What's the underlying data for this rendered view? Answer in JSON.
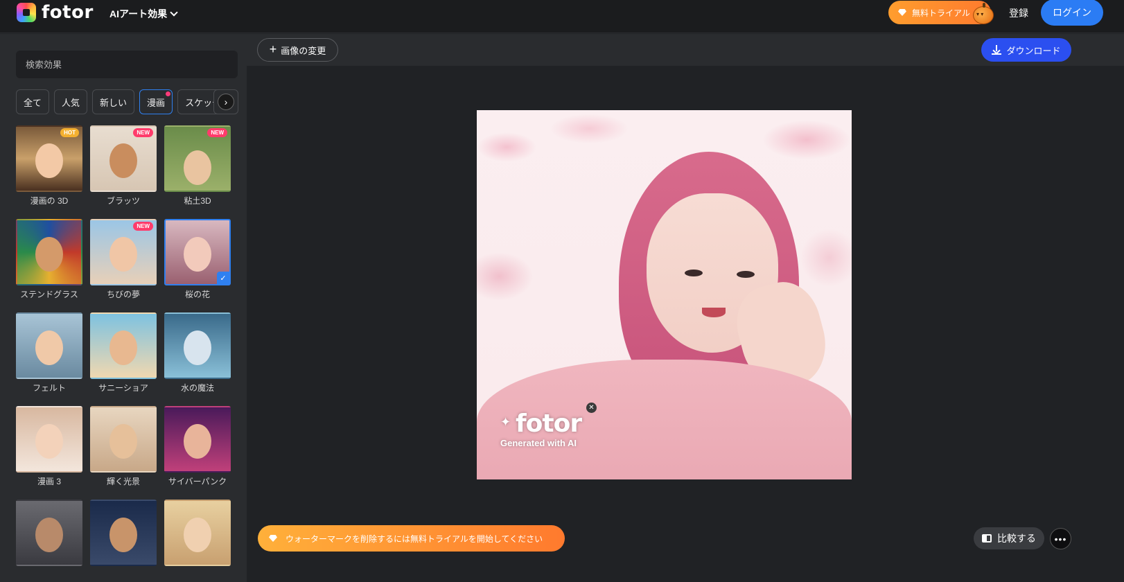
{
  "header": {
    "logo_text": "fotor",
    "ai_menu_label": "AIアート効果",
    "trial_label": "無料トライアル",
    "signup_label": "登録",
    "login_label": "ログイン"
  },
  "sidebar": {
    "search_placeholder": "検索効果",
    "categories": [
      {
        "label": "全て",
        "active": false,
        "dot": false
      },
      {
        "label": "人気",
        "active": false,
        "dot": false
      },
      {
        "label": "新しい",
        "active": false,
        "dot": false
      },
      {
        "label": "漫画",
        "active": true,
        "dot": true
      },
      {
        "label": "スケッチ",
        "active": false,
        "dot": true
      }
    ],
    "next_icon": "chevron-right-icon",
    "effects": [
      {
        "label": "漫画の 3D",
        "badge": "HOT"
      },
      {
        "label": "ブラッツ",
        "badge": "NEW"
      },
      {
        "label": "粘土3D",
        "badge": "NEW"
      },
      {
        "label": "ステンドグラス",
        "badge": ""
      },
      {
        "label": "ちびの夢",
        "badge": "NEW"
      },
      {
        "label": "桜の花",
        "badge": "",
        "selected": true
      },
      {
        "label": "フェルト",
        "badge": ""
      },
      {
        "label": "サニーショア",
        "badge": ""
      },
      {
        "label": "水の魔法",
        "badge": ""
      },
      {
        "label": "漫画 3",
        "badge": ""
      },
      {
        "label": "輝く光景",
        "badge": ""
      },
      {
        "label": "サイバーパンク",
        "badge": ""
      },
      {
        "label": "",
        "badge": ""
      },
      {
        "label": "",
        "badge": ""
      },
      {
        "label": "",
        "badge": ""
      }
    ]
  },
  "toolbar": {
    "change_image_label": "画像の変更",
    "download_label": "ダウンロード"
  },
  "canvas": {
    "watermark_logo": "fotor",
    "watermark_sub": "Generated with AI"
  },
  "footer": {
    "remove_watermark_label": "ウォーターマークを削除するには無料トライアルを開始してください",
    "compare_label": "比較する",
    "more_label": "•••"
  },
  "colors": {
    "accent_blue": "#2b7cf4",
    "download_blue": "#2b4ff0",
    "trial_orange": "#ff8a2e",
    "badge_new": "#ff3b6b",
    "badge_hot": "#f4b030"
  }
}
